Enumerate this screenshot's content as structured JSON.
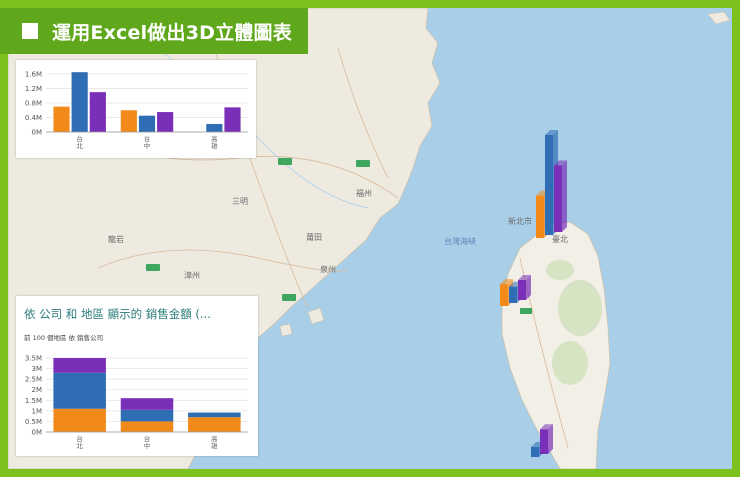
{
  "banner": {
    "title": "運用Excel做出3D立體圖表"
  },
  "colors": {
    "series_a": "#f28a1a",
    "series_b": "#2f6db5",
    "series_c": "#7a2fb8"
  },
  "map": {
    "labels": [
      {
        "text": "福州",
        "kind": "land"
      },
      {
        "text": "新北市",
        "kind": "land"
      },
      {
        "text": "臺北",
        "kind": "land"
      },
      {
        "text": "台灣海峽",
        "kind": "sea"
      },
      {
        "text": "泉州",
        "kind": "land"
      },
      {
        "text": "三明",
        "kind": "land"
      },
      {
        "text": "龍岩",
        "kind": "land"
      },
      {
        "text": "莆田",
        "kind": "land"
      },
      {
        "text": "漳州",
        "kind": "land"
      }
    ]
  },
  "chart_data": [
    {
      "type": "bar",
      "categories": [
        "台北",
        "台中",
        "高雄"
      ],
      "series": [
        {
          "values": [
            700000,
            600000,
            0
          ]
        },
        {
          "values": [
            1650000,
            450000,
            220000
          ]
        },
        {
          "values": [
            1100000,
            550000,
            680000
          ]
        }
      ],
      "yticks": [
        "1.6M",
        "1.2M",
        "0.8M",
        "0.4M",
        "0M"
      ],
      "ylim": [
        0,
        1600000
      ]
    },
    {
      "type": "bar",
      "stacked": true,
      "title": "依 公司 和 地區 顯示的 銷售金額 (...",
      "subtitle": "前 100 個地區    依 銷售公司",
      "categories": [
        "台北",
        "台中",
        "高雄"
      ],
      "series": [
        {
          "values": [
            1100000,
            500000,
            700000
          ]
        },
        {
          "values": [
            1700000,
            550000,
            220000
          ]
        },
        {
          "values": [
            700000,
            550000,
            0
          ]
        }
      ],
      "yticks": [
        "3.5M",
        "3M",
        "2.5M",
        "2M",
        "1.5M",
        "1M",
        "0.5M",
        "0M"
      ],
      "ylim": [
        0,
        3500000
      ]
    }
  ]
}
